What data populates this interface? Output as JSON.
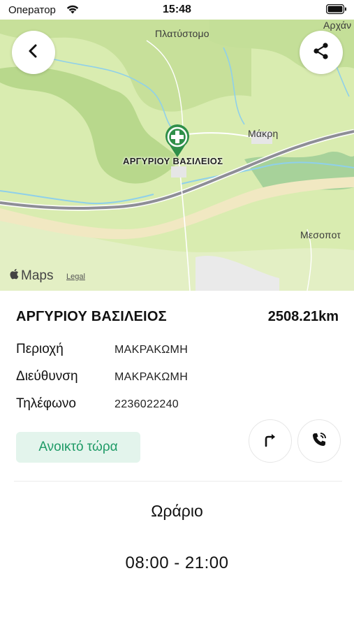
{
  "status_bar": {
    "carrier": "Оператор",
    "time": "15:48",
    "icons": [
      "wifi-icon",
      "battery-icon"
    ]
  },
  "map": {
    "places": [
      "Πλατύστομο",
      "Αρχάν",
      "Μάκρη",
      "Μεσοποτ"
    ],
    "pin_label": "ΑΡΓΥΡΙΟΥ ΒΑΣΙΛΕΙΟΣ",
    "attribution": "Maps",
    "legal": "Legal",
    "colors": {
      "land": "#d9ecb0",
      "terrain": "#bcd98e",
      "road": "#8e8e96",
      "river": "#7ec8e3",
      "pin": "#2f8f49"
    }
  },
  "toolbar": {
    "back_icon": "chevron-left-icon",
    "share_icon": "share-icon"
  },
  "pharmacy": {
    "name": "ΑΡΓΥΡΙΟΥ ΒΑΣΙΛΕΙΟΣ",
    "distance": "2508.21km",
    "area_label": "Περιοχή",
    "area_value": "ΜΑΚΡΑΚΩΜΗ",
    "address_label": "Διεύθυνση",
    "address_value": "ΜΑΚΡΑΚΩΜΗ",
    "phone_label": "Τηλέφωνο",
    "phone_value": "2236022240",
    "open_status": "Ανοικτό τώρα",
    "accent_color": "#1e9a66"
  },
  "actions": {
    "directions_icon": "turn-right-icon",
    "call_icon": "phone-call-icon"
  },
  "hours": {
    "title": "Ωράριο",
    "value": "08:00 - 21:00"
  }
}
